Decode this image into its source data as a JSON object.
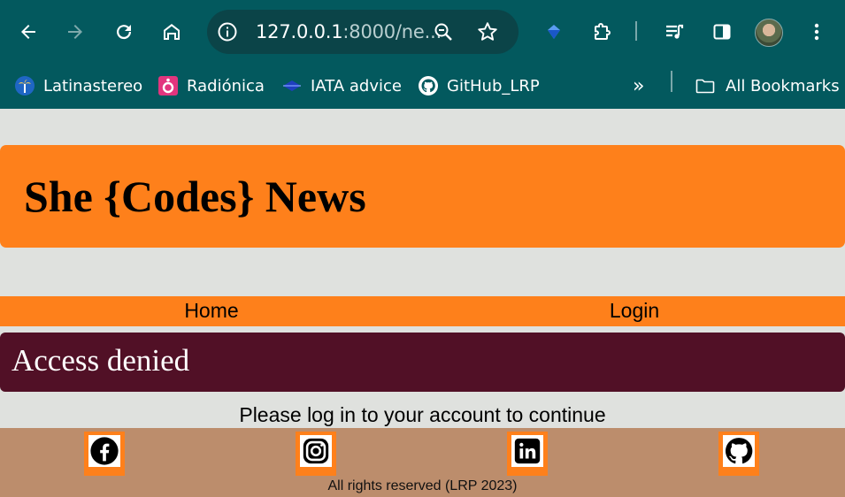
{
  "browser": {
    "url_host": "127.0.0.1",
    "url_rest": ":8000/ne...",
    "bookmarks": [
      {
        "label": "Latinastereo",
        "icon": "palm-radio-icon"
      },
      {
        "label": "Radiónica",
        "icon": "radio-station-icon"
      },
      {
        "label": "IATA advice",
        "icon": "iata-icon"
      },
      {
        "label": "GitHub_LRP",
        "icon": "github-icon"
      }
    ],
    "all_bookmarks": "All Bookmarks",
    "overflow_label": "»"
  },
  "site": {
    "title": "She {Codes} News",
    "nav": {
      "home": "Home",
      "login": "Login"
    },
    "banner": "Access denied",
    "message": "Please log in to your account to continue",
    "footer": {
      "social": [
        "facebook-icon",
        "instagram-icon",
        "linkedin-icon",
        "github-icon"
      ],
      "copyright": "All rights reserved (LRP 2023)"
    }
  },
  "colors": {
    "chrome": "#03595e",
    "accent": "#fe801b",
    "banner": "#511026",
    "footer": "#bc8d6c",
    "page_bg": "#dfe1de"
  }
}
